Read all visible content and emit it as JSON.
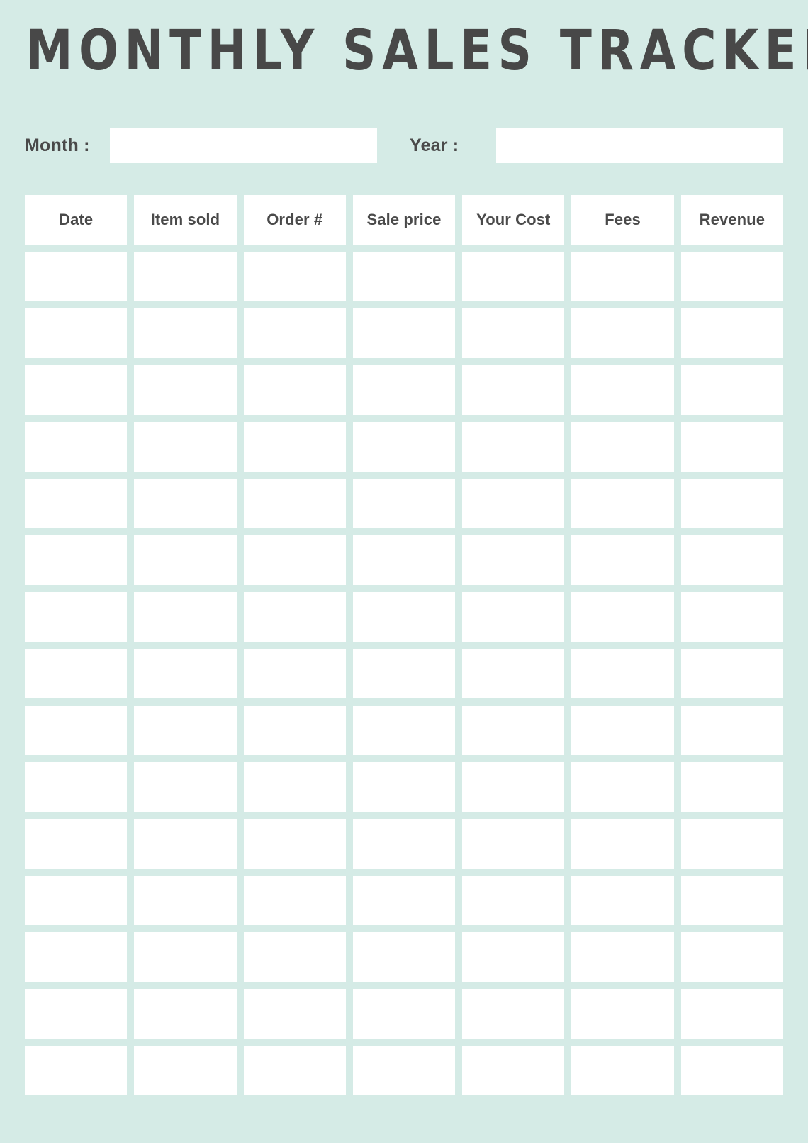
{
  "page": {
    "title": "MONTHLY SALES TRACKER",
    "background_color": "#d5ebe6",
    "text_color": "#4a4a4a",
    "cell_color": "#ffffff"
  },
  "meta": {
    "month": {
      "label": "Month :",
      "value": "",
      "placeholder": ""
    },
    "year": {
      "label": "Year :",
      "value": "",
      "placeholder": ""
    }
  },
  "table": {
    "columns": [
      "Date",
      "Item sold",
      "Order #",
      "Sale price",
      "Your Cost",
      "Fees",
      "Revenue"
    ],
    "row_count": 15,
    "rows": [
      [
        "",
        "",
        "",
        "",
        "",
        "",
        ""
      ],
      [
        "",
        "",
        "",
        "",
        "",
        "",
        ""
      ],
      [
        "",
        "",
        "",
        "",
        "",
        "",
        ""
      ],
      [
        "",
        "",
        "",
        "",
        "",
        "",
        ""
      ],
      [
        "",
        "",
        "",
        "",
        "",
        "",
        ""
      ],
      [
        "",
        "",
        "",
        "",
        "",
        "",
        ""
      ],
      [
        "",
        "",
        "",
        "",
        "",
        "",
        ""
      ],
      [
        "",
        "",
        "",
        "",
        "",
        "",
        ""
      ],
      [
        "",
        "",
        "",
        "",
        "",
        "",
        ""
      ],
      [
        "",
        "",
        "",
        "",
        "",
        "",
        ""
      ],
      [
        "",
        "",
        "",
        "",
        "",
        "",
        ""
      ],
      [
        "",
        "",
        "",
        "",
        "",
        "",
        ""
      ],
      [
        "",
        "",
        "",
        "",
        "",
        "",
        ""
      ],
      [
        "",
        "",
        "",
        "",
        "",
        "",
        ""
      ],
      [
        "",
        "",
        "",
        "",
        "",
        "",
        ""
      ]
    ]
  }
}
